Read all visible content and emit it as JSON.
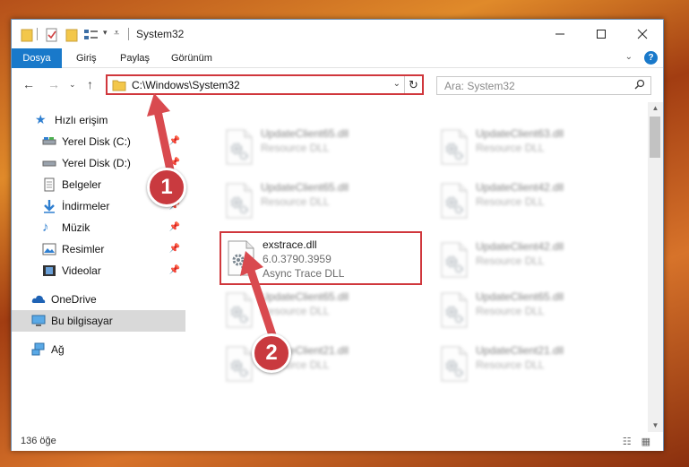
{
  "window": {
    "title": "System32"
  },
  "ribbon": {
    "tabs": [
      "Dosya",
      "Giriş",
      "Paylaş",
      "Görünüm"
    ],
    "active_tab": "Dosya"
  },
  "address": {
    "path": "C:\\Windows\\System32"
  },
  "search": {
    "placeholder": "Ara: System32"
  },
  "sidebar": {
    "quick_access": "Hızlı erişim",
    "items": [
      {
        "label": "Yerel Disk (C:)",
        "icon": "drive-icon",
        "pinned": true
      },
      {
        "label": "Yerel Disk (D:)",
        "icon": "drive-icon",
        "pinned": true
      },
      {
        "label": "Belgeler",
        "icon": "documents-icon",
        "pinned": true
      },
      {
        "label": "İndirmeler",
        "icon": "downloads-icon",
        "pinned": true
      },
      {
        "label": "Müzik",
        "icon": "music-icon",
        "pinned": true
      },
      {
        "label": "Resimler",
        "icon": "pictures-icon",
        "pinned": true
      },
      {
        "label": "Videolar",
        "icon": "videos-icon",
        "pinned": true
      }
    ],
    "onedrive": "OneDrive",
    "this_pc": "Bu bilgisayar",
    "network": "Ağ"
  },
  "files": {
    "left_column": [
      {
        "name": "UpdateClient65.dll",
        "line2": "Resource DLL"
      },
      {
        "name": "UpdateClient65.dll",
        "line2": "Resource DLL"
      },
      {
        "name": "exstrace.dll",
        "line2": "6.0.3790.3959",
        "line3": "Async Trace DLL"
      },
      {
        "name": "UpdateClient65.dll",
        "line2": "Resource DLL"
      },
      {
        "name": "UpdateClient21.dll",
        "line2": "Resource DLL"
      }
    ],
    "right_column": [
      {
        "name": "UpdateClient63.dll",
        "line2": "Resource DLL"
      },
      {
        "name": "UpdateClient42.dll",
        "line2": "Resource DLL"
      },
      {
        "name": "UpdateClient42.dll",
        "line2": "Resource DLL"
      },
      {
        "name": "UpdateClient65.dll",
        "line2": "Resource DLL"
      },
      {
        "name": "UpdateClient21.dll",
        "line2": "Resource DLL"
      }
    ]
  },
  "status": {
    "item_count": "136 öğe"
  },
  "annotations": {
    "badge1": "1",
    "badge2": "2"
  },
  "colors": {
    "accent": "#1979ca",
    "highlight": "#d0373c",
    "badge": "#c93a3f"
  }
}
